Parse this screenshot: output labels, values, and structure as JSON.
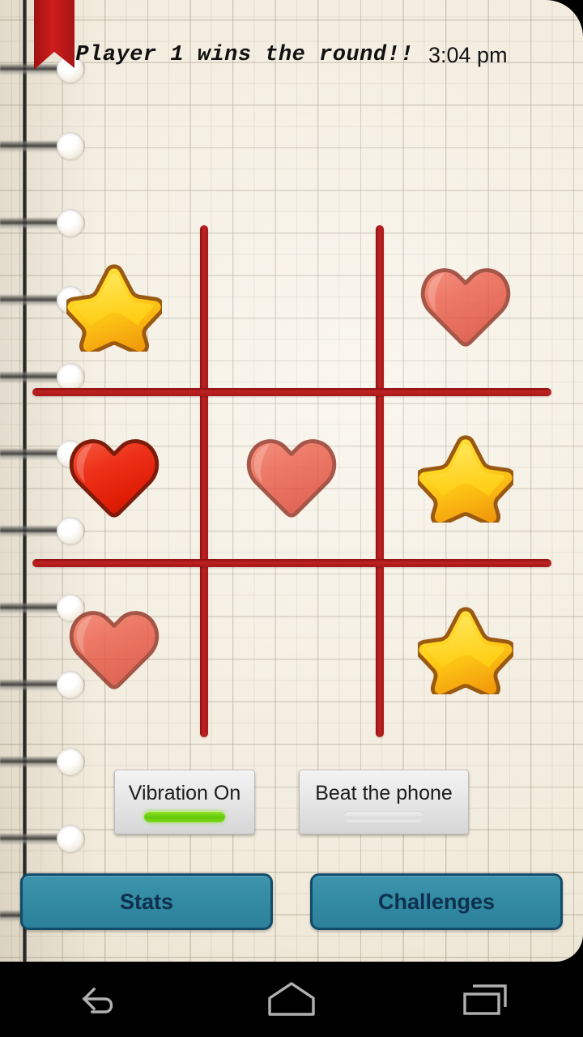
{
  "header": {
    "status_message": "Player 1 wins the round!!",
    "clock": "3:04 pm"
  },
  "board": {
    "rows": 3,
    "cols": 3,
    "line_color": "#b01a1a",
    "cells": [
      {
        "index": 0,
        "position": "top-left",
        "mark": "star",
        "state": "placed"
      },
      {
        "index": 1,
        "position": "top-center",
        "mark": "empty",
        "state": "empty"
      },
      {
        "index": 2,
        "position": "top-right",
        "mark": "heart",
        "state": "placed"
      },
      {
        "index": 3,
        "position": "middle-left",
        "mark": "heart",
        "state": "highlighted"
      },
      {
        "index": 4,
        "position": "middle-center",
        "mark": "heart",
        "state": "placed"
      },
      {
        "index": 5,
        "position": "middle-right",
        "mark": "star",
        "state": "placed"
      },
      {
        "index": 6,
        "position": "bottom-left",
        "mark": "heart",
        "state": "placed"
      },
      {
        "index": 7,
        "position": "bottom-center",
        "mark": "empty",
        "state": "empty"
      },
      {
        "index": 8,
        "position": "bottom-right",
        "mark": "star",
        "state": "placed"
      }
    ]
  },
  "toggles": [
    {
      "label": "Vibration On",
      "state": "on",
      "indicator_color": "#76d412"
    },
    {
      "label": "Beat the phone",
      "state": "off",
      "indicator_color": "#e3e3e3"
    }
  ],
  "actions": [
    {
      "label": "Stats",
      "color": "#328aa3"
    },
    {
      "label": "Challenges",
      "color": "#328aa3"
    }
  ],
  "navbar": {
    "buttons": [
      {
        "name": "back",
        "icon": "back-arrow-icon"
      },
      {
        "name": "home",
        "icon": "home-icon"
      },
      {
        "name": "recent",
        "icon": "recent-apps-icon"
      }
    ]
  },
  "theme": {
    "paper": "#f6f0e2",
    "grid_line": "#aaa392",
    "board_red": "#b01a1a",
    "star_fill": "#ffd31f",
    "star_shade": "#f59e13",
    "star_outline": "#9c5a10",
    "heart_fill": "#e8503e",
    "heart_outline": "#8f2c1d",
    "ribbon": "#c81b1b",
    "button_teal": "#328aa3",
    "button_border": "#134b6b"
  }
}
